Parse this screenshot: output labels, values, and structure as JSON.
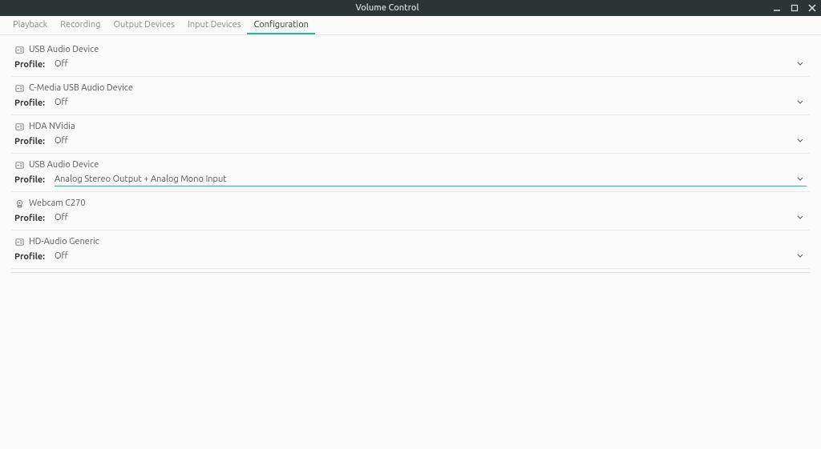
{
  "window": {
    "title": "Volume Control"
  },
  "tabs": [
    {
      "label": "Playback",
      "active": false
    },
    {
      "label": "Recording",
      "active": false
    },
    {
      "label": "Output Devices",
      "active": false
    },
    {
      "label": "Input Devices",
      "active": false
    },
    {
      "label": "Configuration",
      "active": true
    }
  ],
  "profile_label": "Profile:",
  "devices": [
    {
      "name": "USB Audio Device",
      "icon": "card",
      "profile": "Off",
      "highlighted": false
    },
    {
      "name": "C-Media USB Audio Device",
      "icon": "card",
      "profile": "Off",
      "highlighted": false
    },
    {
      "name": "HDA NVidia",
      "icon": "card",
      "profile": "Off",
      "highlighted": false
    },
    {
      "name": "USB Audio Device",
      "icon": "card",
      "profile": "Analog Stereo Output + Analog Mono Input",
      "highlighted": true
    },
    {
      "name": "Webcam C270",
      "icon": "webcam",
      "profile": "Off",
      "highlighted": false
    },
    {
      "name": "HD-Audio Generic",
      "icon": "card",
      "profile": "Off",
      "highlighted": false
    }
  ]
}
